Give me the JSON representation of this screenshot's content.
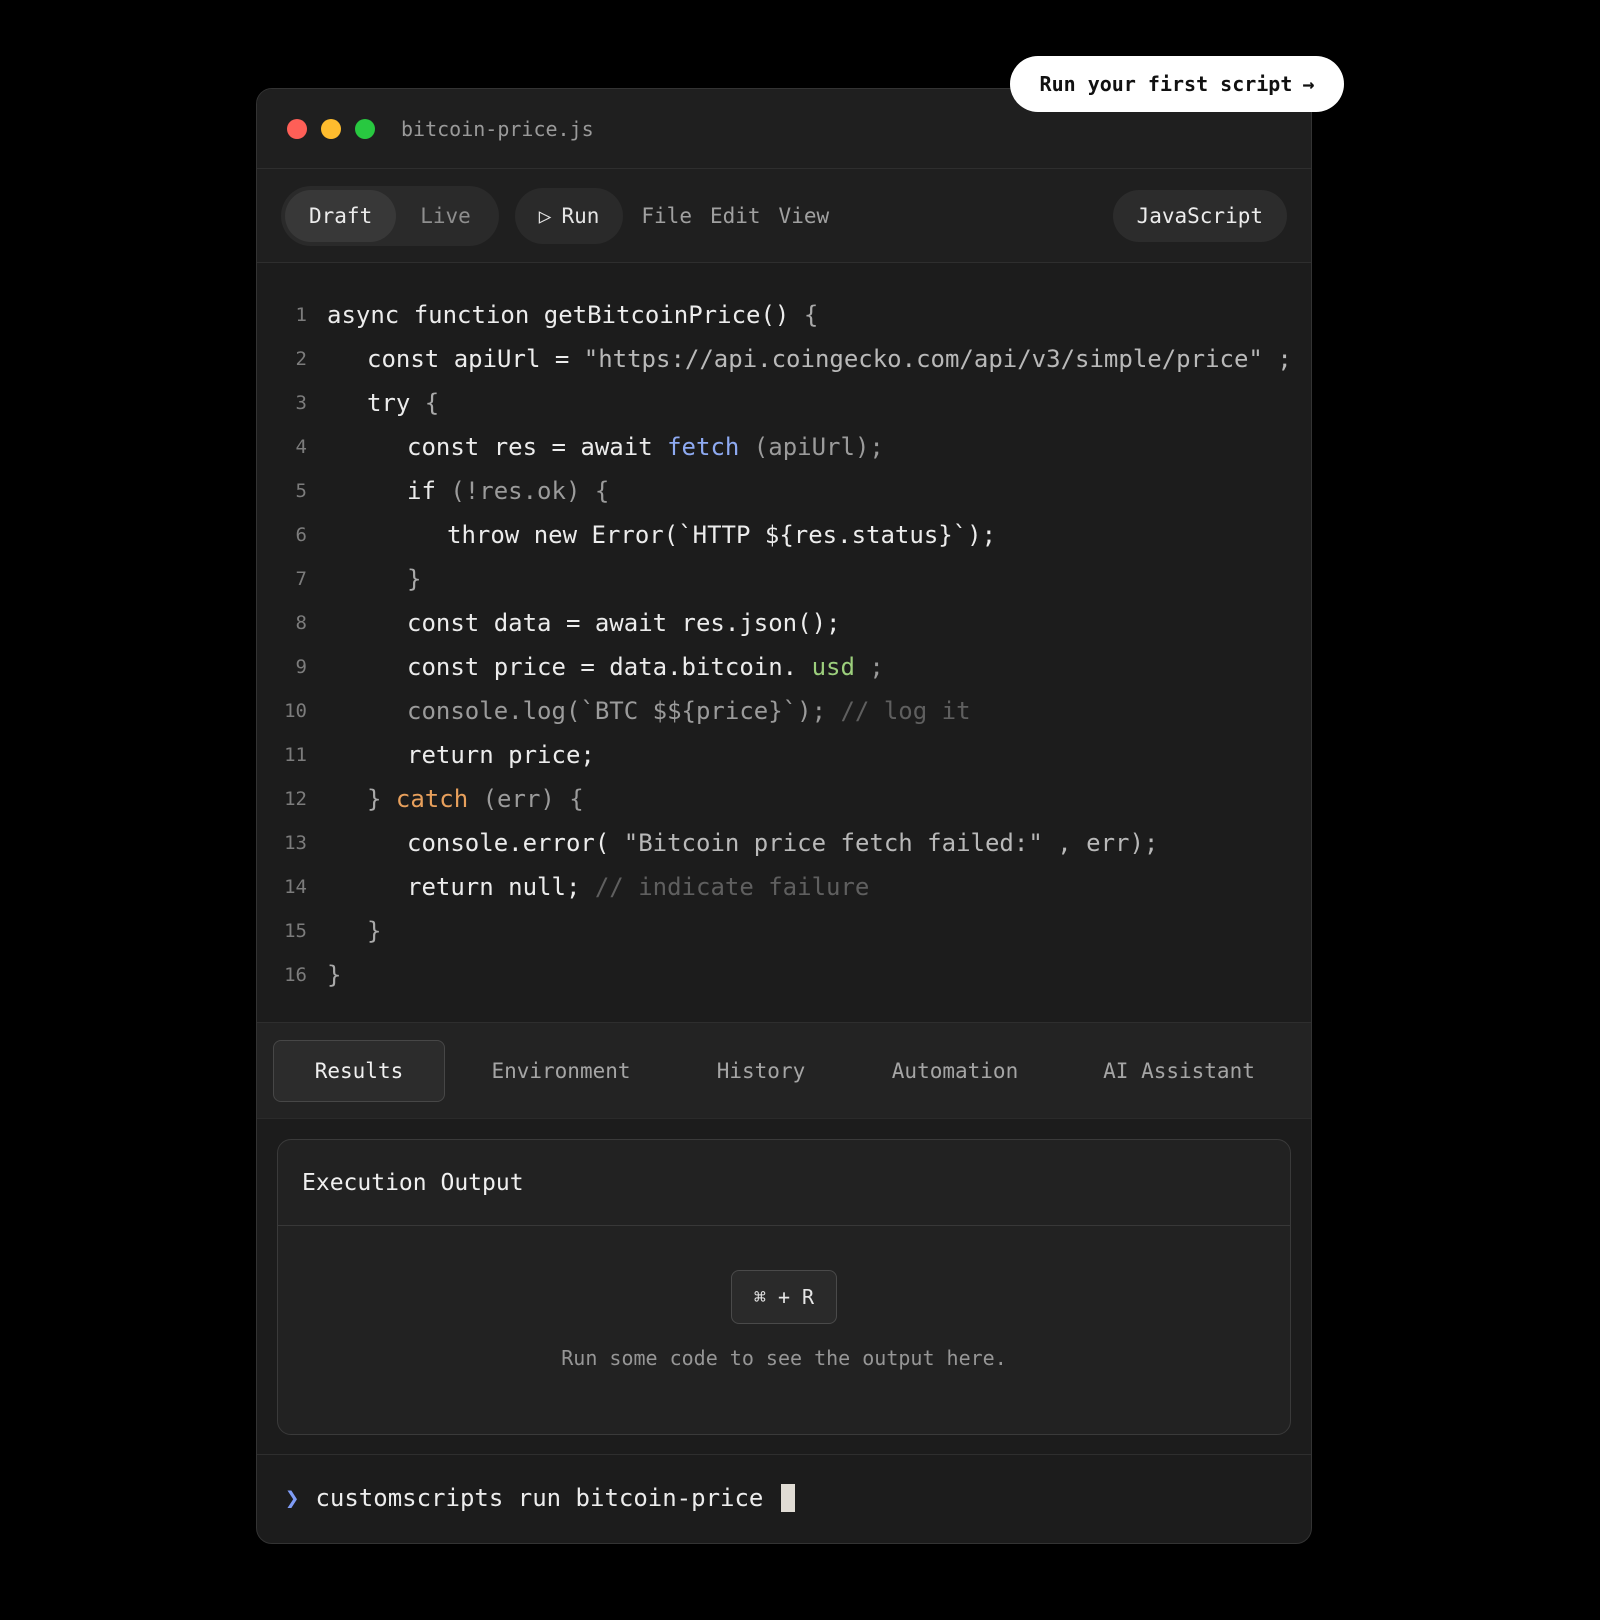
{
  "cta": {
    "label": "Run your first script",
    "arrow": "→"
  },
  "window": {
    "filename": "bitcoin-price.js"
  },
  "toolbar": {
    "modes": [
      "Draft",
      "Live"
    ],
    "active_mode": "Draft",
    "run_icon": "▷",
    "run_label": "Run",
    "menu": [
      "File",
      "Edit",
      "View"
    ],
    "language": "JavaScript"
  },
  "code_lines": [
    {
      "n": "1",
      "indent": 0,
      "parts": [
        {
          "t": "async function getBitcoinPrice() ",
          "c": "code"
        },
        {
          "t": "{",
          "c": "c-punct"
        }
      ]
    },
    {
      "n": "2",
      "indent": 1,
      "parts": [
        {
          "t": "const apiUrl = ",
          "c": "code"
        },
        {
          "t": "\"https://api.coingecko.com/api/v3/simple/price\" ;",
          "c": "c-str"
        }
      ]
    },
    {
      "n": "3",
      "indent": 1,
      "parts": [
        {
          "t": "try ",
          "c": "code"
        },
        {
          "t": "{",
          "c": "c-punct"
        }
      ]
    },
    {
      "n": "4",
      "indent": 2,
      "parts": [
        {
          "t": "const res = await ",
          "c": "code"
        },
        {
          "t": "fetch",
          "c": "c-blue"
        },
        {
          "t": " (apiUrl);",
          "c": "c-muted"
        }
      ]
    },
    {
      "n": "5",
      "indent": 2,
      "parts": [
        {
          "t": "if ",
          "c": "code"
        },
        {
          "t": "(!res.ok) {",
          "c": "c-muted"
        }
      ]
    },
    {
      "n": "6",
      "indent": 3,
      "parts": [
        {
          "t": "throw new Error(`HTTP ${res.status}`);",
          "c": "code"
        }
      ]
    },
    {
      "n": "7",
      "indent": 2,
      "parts": [
        {
          "t": "}",
          "c": "c-punct"
        }
      ]
    },
    {
      "n": "8",
      "indent": 2,
      "parts": [
        {
          "t": "const data = await res.json();",
          "c": "code"
        }
      ]
    },
    {
      "n": "9",
      "indent": 2,
      "parts": [
        {
          "t": "const price = data.bitcoin. ",
          "c": "code"
        },
        {
          "t": "usd",
          "c": "c-green"
        },
        {
          "t": " ;",
          "c": "c-muted"
        }
      ]
    },
    {
      "n": "10",
      "indent": 2,
      "parts": [
        {
          "t": "console.log(`BTC $${price}`); ",
          "c": "c-muted"
        },
        {
          "t": "// log it",
          "c": "c-comment"
        }
      ]
    },
    {
      "n": "11",
      "indent": 2,
      "parts": [
        {
          "t": "return price;",
          "c": "code"
        }
      ]
    },
    {
      "n": "12",
      "indent": 1,
      "parts": [
        {
          "t": "} ",
          "c": "c-punct"
        },
        {
          "t": "catch",
          "c": "c-orange"
        },
        {
          "t": " (err) {",
          "c": "c-muted"
        }
      ]
    },
    {
      "n": "13",
      "indent": 2,
      "parts": [
        {
          "t": "console.error( ",
          "c": "code"
        },
        {
          "t": "\"Bitcoin price fetch failed:\" , err);",
          "c": "c-str"
        }
      ]
    },
    {
      "n": "14",
      "indent": 2,
      "parts": [
        {
          "t": "return null; ",
          "c": "code"
        },
        {
          "t": "// indicate failure",
          "c": "c-comment"
        }
      ]
    },
    {
      "n": "15",
      "indent": 1,
      "parts": [
        {
          "t": "}",
          "c": "c-punct"
        }
      ]
    },
    {
      "n": "16",
      "indent": 0,
      "parts": [
        {
          "t": "}",
          "c": "c-punct"
        }
      ]
    }
  ],
  "tabs": [
    "Results",
    "Environment",
    "History",
    "Automation",
    "AI Assistant"
  ],
  "active_tab": "Results",
  "output": {
    "title": "Execution Output",
    "shortcut": "⌘ + R",
    "hint": "Run some code to see the output here."
  },
  "terminal": {
    "prompt": "❯",
    "command": "customscripts run bitcoin-price"
  }
}
